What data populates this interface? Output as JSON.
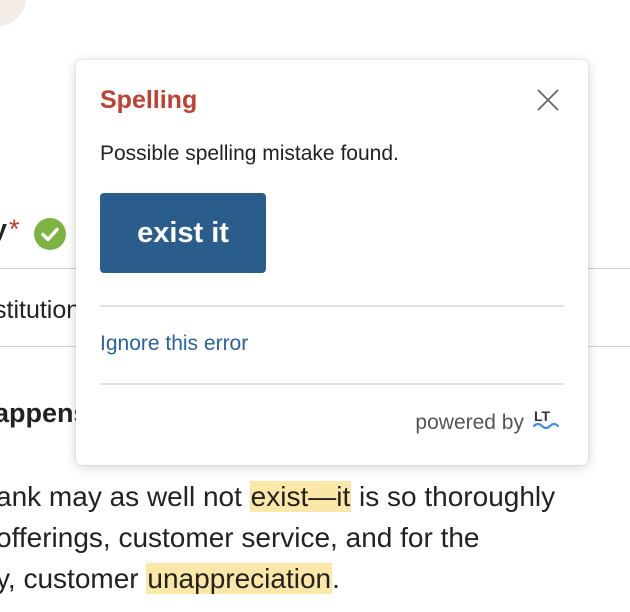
{
  "background": {
    "field_label": "y",
    "required_marker": "*",
    "answer_text": "stitutional",
    "question_label": "appens",
    "body_lines": [
      {
        "before": "ank may as well not ",
        "highlight": "exist—it",
        "after": " is so thoroughly"
      },
      {
        "before": " offerings, customer service, and for the",
        "highlight": "",
        "after": ""
      },
      {
        "before": "y, customer ",
        "highlight": "unappreciation",
        "after": "."
      }
    ],
    "highlight_color": "#fbe7a8",
    "check_color": "#7cb342"
  },
  "popup": {
    "title": "Spelling",
    "title_color": "#c13f31",
    "message": "Possible spelling mistake found.",
    "suggestion": "exist it",
    "suggestion_color": "#2a5d8c",
    "ignore_label": "Ignore this error",
    "powered_by": "powered by",
    "close_icon": "close-icon",
    "logo_icon": "languagetool-logo-icon"
  }
}
